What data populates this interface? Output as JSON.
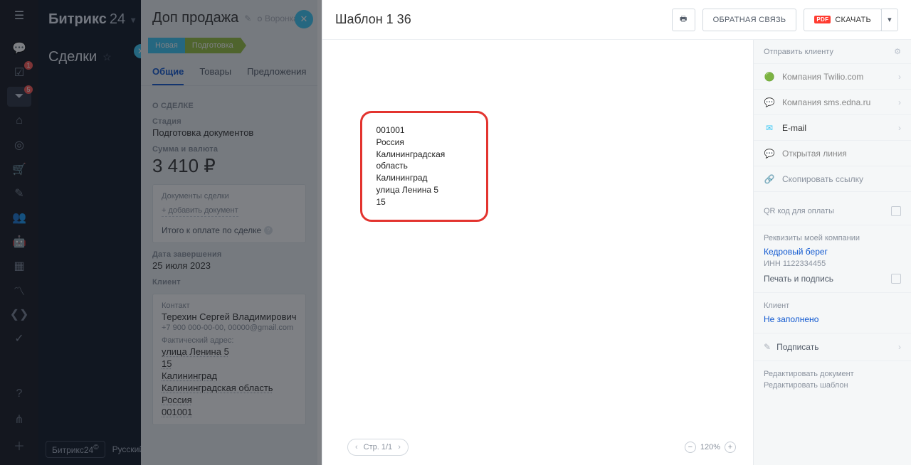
{
  "brand": {
    "name": "Битрикс",
    "suffix": "24"
  },
  "section": {
    "title": "Сделки"
  },
  "brand_bottom": {
    "logo": "Битрикс24",
    "lang": "Русский"
  },
  "leftnav": {
    "badge_checklist": "1",
    "badge_filter": "5"
  },
  "deal": {
    "title": "Доп продажа",
    "funnel_label": "Воронка",
    "stages": [
      "Новая",
      "Подготовка"
    ],
    "tabs": {
      "general": "Общие",
      "products": "Товары",
      "offers": "Предложения"
    },
    "section_about": "О СДЕЛКЕ",
    "stage_label": "Стадия",
    "stage_value": "Подготовка документов",
    "amount_label": "Сумма и валюта",
    "amount_value": "3 410 ₽",
    "docs_title": "Документы сделки",
    "docs_add": "+ добавить документ",
    "docs_total": "Итого к оплате по сделке",
    "date_label": "Дата завершения",
    "date_value": "25 июля 2023",
    "client_label": "Клиент",
    "contact_label": "Контакт",
    "contact_name": "Терехин Сергей Владимирович",
    "contact_phone": "+7 900 000-00-00, 00000@gmail.com",
    "addr_label": "Фактический адрес:",
    "addr": {
      "street": "улица Ленина 5",
      "house": "15",
      "city": "Калининград",
      "region": "Калининградская область",
      "country": "Россия",
      "zip": "001001"
    }
  },
  "tpl": {
    "title": "Шаблон 1 36",
    "btn_feedback": "ОБРАТНАЯ СВЯЗЬ",
    "btn_download": "СКАЧАТЬ",
    "pdf_badge": "PDF",
    "page_label": "Стр. 1/1",
    "zoom": "120%",
    "doc_lines": {
      "l1": "001001",
      "l2": "Россия",
      "l3": "Калининградская область",
      "l4": "Калининград",
      "l5": "улица Ленина 5",
      "l6": "15"
    },
    "side": {
      "send_label": "Отправить клиенту",
      "items": {
        "twilio": "Компания Twilio.com",
        "edna": "Компания sms.edna.ru",
        "email": "E-mail",
        "openline": "Открытая линия",
        "copy": "Скопировать ссылку"
      },
      "qr_label": "QR код для оплаты",
      "req_label": "Реквизиты моей компании",
      "req_company": "Кедровый берег",
      "req_inn": "ИНН 1122334455",
      "stamp_label": "Печать и подпись",
      "client_label": "Клиент",
      "client_value": "Не заполнено",
      "sign_label": "Подписать",
      "edit_doc": "Редактировать документ",
      "edit_tpl": "Редактировать шаблон"
    }
  }
}
